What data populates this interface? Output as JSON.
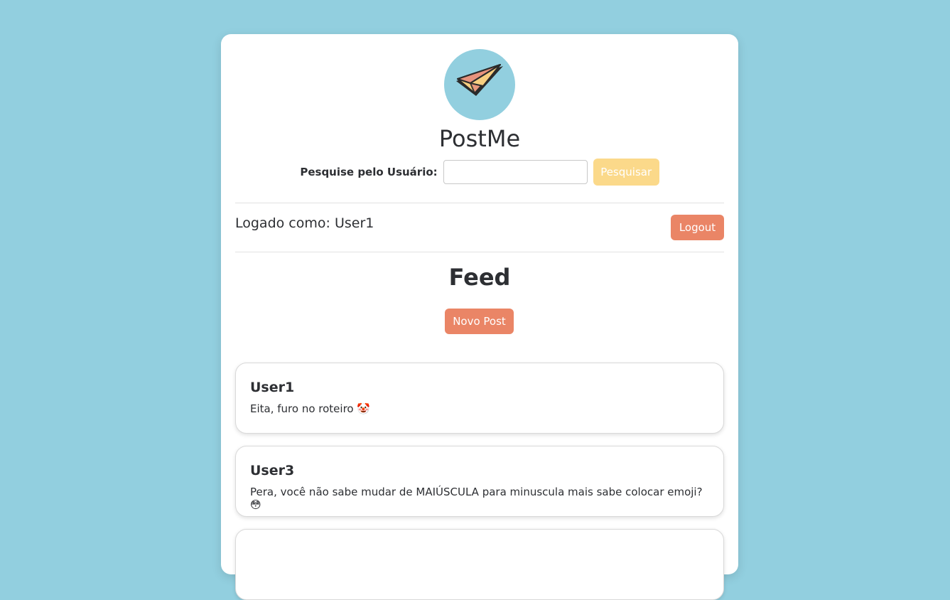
{
  "brand": {
    "name": "PostMe",
    "logo_icon": "paper-plane-icon"
  },
  "search": {
    "label": "Pesquise pelo Usuário:",
    "placeholder": "",
    "value": "",
    "button_label": "Pesquisar"
  },
  "session": {
    "status_text": "Logado como: User1",
    "logout_label": "Logout"
  },
  "feed": {
    "title": "Feed",
    "new_post_label": "Novo Post",
    "posts": [
      {
        "user": "User1",
        "text": "Eita, furo no roteiro 🤡"
      },
      {
        "user": "User3",
        "text": "Pera, você não sabe mudar de MAIÚSCULA para minuscula mais sabe colocar emoji? 😳"
      },
      {
        "user": "",
        "text": ""
      }
    ]
  },
  "colors": {
    "background": "#92cfdf",
    "accent_orange": "#ea8566",
    "accent_yellow": "#fbd98a",
    "card": "#ffffff"
  }
}
